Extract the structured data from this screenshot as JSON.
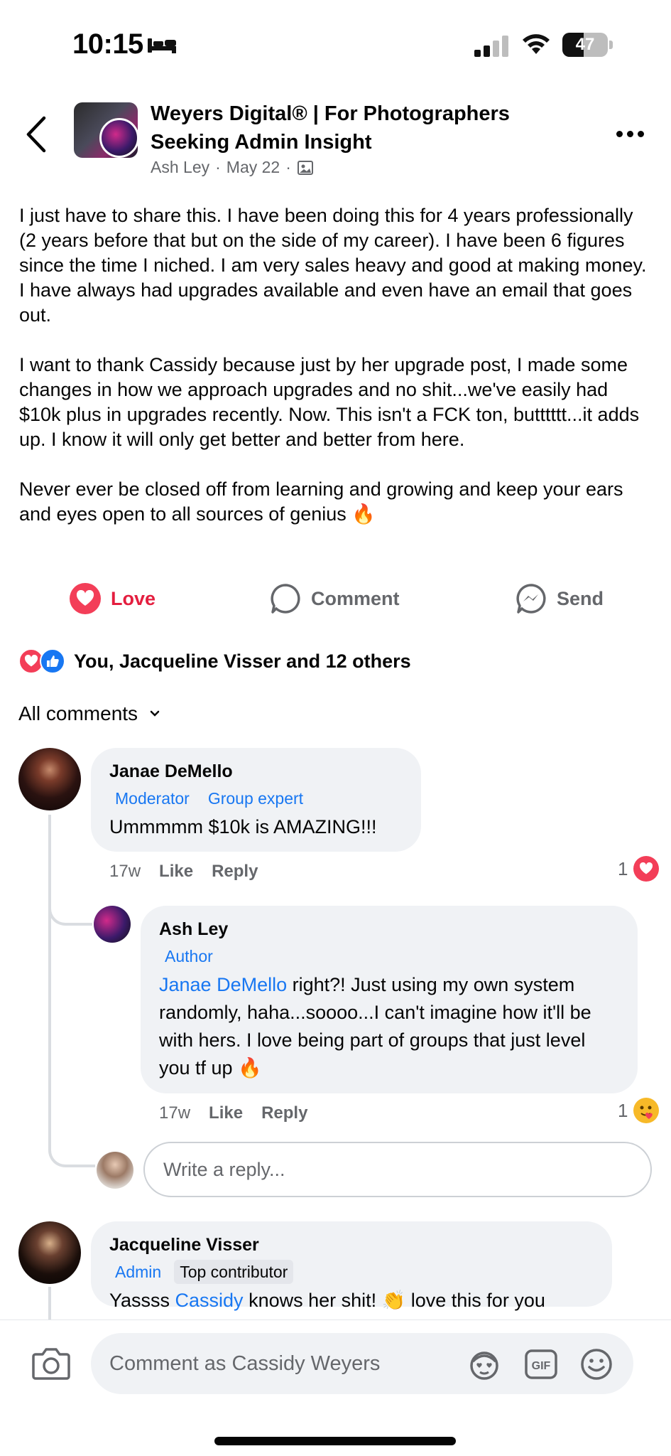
{
  "status_bar": {
    "time": "10:15",
    "battery_level": "47",
    "battery_fraction": 0.47
  },
  "post": {
    "group_title": "Weyers Digital® | For Photographers Seeking Admin Insight",
    "author": "Ash Ley",
    "date": "May 22",
    "body": [
      "I just have to share this. I have been doing this for 4 years professionally (2 years before that but on the side of my career). I have been 6 figures since the time I niched. I am very sales heavy and good at making money. I have always had upgrades available and even have an email that goes out.",
      "I want to thank Cassidy because just by her upgrade post, I made some changes in how we approach upgrades and no shit...we've easily had $10k plus in upgrades recently. Now. This isn't a FCK ton, butttttt...it adds up. I know it will only get better and better from here.",
      "Never ever be closed off from learning and growing and keep your ears and eyes open to all sources of genius 🔥"
    ]
  },
  "actions": {
    "love_label": "Love",
    "comment_label": "Comment",
    "send_label": "Send"
  },
  "reactions_summary": "You, Jacqueline Visser and 12 others",
  "comments_filter": "All comments",
  "comments": [
    {
      "name": "Janae DeMello",
      "badges": [
        "Moderator",
        "Group expert"
      ],
      "text": "Ummmmm $10k is AMAZING!!!",
      "time": "17w",
      "like": "Like",
      "reply": "Reply",
      "reaction_count": "1"
    },
    {
      "name": "Ash Ley",
      "badges": [
        "Author"
      ],
      "mention": "Janae DeMello",
      "text": " right?! Just using my own system randomly, haha...soooo...I can't imagine how it'll be with hers. I love being part of groups that just level you tf up 🔥",
      "time": "17w",
      "like": "Like",
      "reply": "Reply",
      "reaction_count": "1"
    },
    {
      "name": "Jacqueline Visser",
      "badges": [
        "Admin",
        "Top contributor"
      ],
      "text_before": "Yassss ",
      "mention": "Cassidy",
      "text_after": " knows her shit! 👏 love this for you"
    }
  ],
  "reply_placeholder": "Write a reply...",
  "comment_bar": {
    "placeholder": "Comment as Cassidy Weyers"
  },
  "colors": {
    "love": "#f33e58",
    "link": "#1877f2",
    "muted": "#65676b",
    "bubble": "#f0f2f5"
  },
  "icons": [
    "back-icon",
    "more-icon",
    "photo-icon",
    "love-icon",
    "comment-icon",
    "messenger-icon",
    "like-icon",
    "chevron-down-icon",
    "camera-icon",
    "avatar-sticker-icon",
    "gif-icon",
    "emoji-icon",
    "bed-icon",
    "signal-icon",
    "wifi-icon",
    "battery-icon"
  ]
}
